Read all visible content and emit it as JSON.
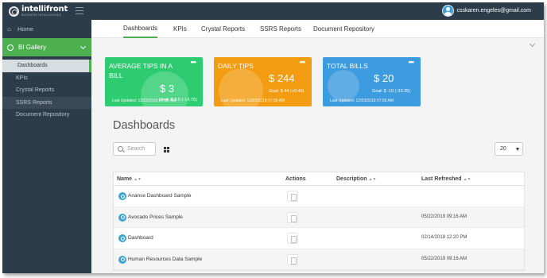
{
  "header": {
    "logo_name": "intelli",
    "logo_name_2": "front",
    "logo_sub": "BUSINESS INTELLIGENCE",
    "user_email": "csskaren.engeles@gmail.com"
  },
  "sidebar": {
    "home_label": "Home",
    "section_label": "BI Gallery",
    "items": [
      {
        "label": "Dashboards",
        "active": true
      },
      {
        "label": "KPIs"
      },
      {
        "label": "Crystal Reports"
      },
      {
        "label": "SSRS Reports"
      },
      {
        "label": "Document Repository"
      }
    ]
  },
  "tabs": [
    {
      "label": "Dashboards",
      "active": true
    },
    {
      "label": "KPIs"
    },
    {
      "label": "Crystal Reports"
    },
    {
      "label": "SSRS Reports"
    },
    {
      "label": "Document Repository"
    }
  ],
  "kpis": [
    {
      "title": "AVERAGE TIPS IN A BILL",
      "value": "$ 3",
      "goal": "Goal: $ 3.5 (-14.76)",
      "updated": "Last Updated: 12/03/2019 07:55 AM",
      "color": "#2ecc71"
    },
    {
      "title": "DAILY TIPS",
      "value": "$ 244",
      "goal": "Goal: $ 44 (+0.46)",
      "updated": "Last Updated: 12/03/2019 07:55 AM",
      "color": "#f39c12"
    },
    {
      "title": "TOTAL BILLS",
      "value": "$ 20",
      "goal": "Goal: $ -10 (-33.35)",
      "updated": "Last Updated: 12/03/2019 07:55 AM",
      "color": "#3d9be0"
    }
  ],
  "page_title": "Dashboards",
  "search": {
    "placeholder": "Search"
  },
  "page_size": "20",
  "table": {
    "columns": [
      "Name",
      "Actions",
      "Description",
      "Last Refreshed"
    ],
    "rows": [
      {
        "name": "Ananse Dashboard Sample",
        "description": "",
        "last_refreshed": ""
      },
      {
        "name": "Avocado Prices Sample",
        "description": "",
        "last_refreshed": "05/22/2019 09:16 AM"
      },
      {
        "name": "Dashboard",
        "description": "",
        "last_refreshed": "02/14/2018 12:20 PM"
      },
      {
        "name": "Human Resources Data Sample",
        "description": "",
        "last_refreshed": "05/22/2019 09:16 AM"
      }
    ]
  },
  "colors": {
    "accent_green": "#4caf50",
    "sidebar_bg": "#2d3c4a",
    "row_icon": "#3aa6d6"
  }
}
